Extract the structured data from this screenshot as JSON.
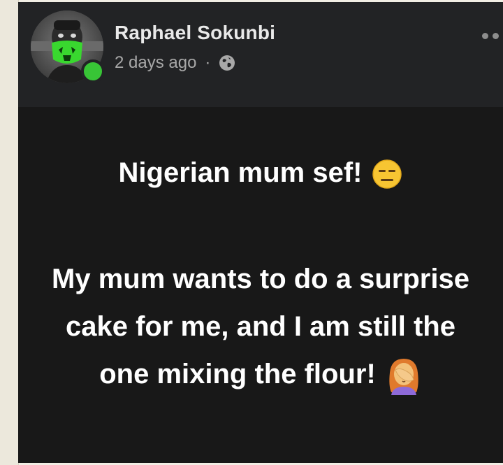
{
  "post": {
    "author": "Raphael Sokunbi",
    "timestamp": "2 days ago",
    "separator": "·",
    "privacy_icon": "globe-icon",
    "headline": "Nigerian mum sef!",
    "headline_emoji": "expressionless-face-emoji",
    "message": "My mum wants to do a surprise cake for me, and I am still the one mixing the flour!",
    "message_emoji": "woman-facepalming-emoji"
  },
  "colors": {
    "header_bg": "#222325",
    "body_bg": "#181818",
    "online_status": "#38c536",
    "text": "#ffffff"
  }
}
